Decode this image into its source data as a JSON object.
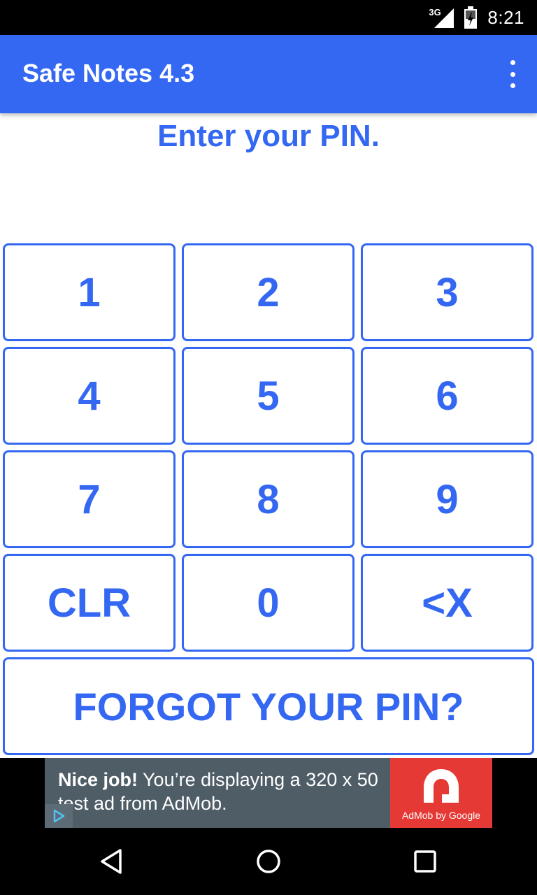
{
  "status_bar": {
    "network": "3G",
    "time": "8:21",
    "icons": [
      "signal-icon",
      "battery-icon"
    ]
  },
  "app_bar": {
    "title": "Safe Notes 4.3",
    "menu_icon": "overflow-menu-icon"
  },
  "prompt": "Enter your PIN.",
  "keypad": {
    "keys": [
      "1",
      "2",
      "3",
      "4",
      "5",
      "6",
      "7",
      "8",
      "9",
      "CLR",
      "0",
      "<X"
    ],
    "forgot_label": "FORGOT YOUR PIN?"
  },
  "ad": {
    "headline": "Nice job!",
    "body": "You’re displaying a 320 x 50 test ad from AdMob.",
    "brand": "AdMob by Google"
  },
  "nav_bar": {
    "icons": [
      "back-icon",
      "home-icon",
      "recents-icon"
    ]
  },
  "colors": {
    "accent": "#3468f2",
    "ad_background": "#4f5d67",
    "admob_red": "#e53935"
  }
}
